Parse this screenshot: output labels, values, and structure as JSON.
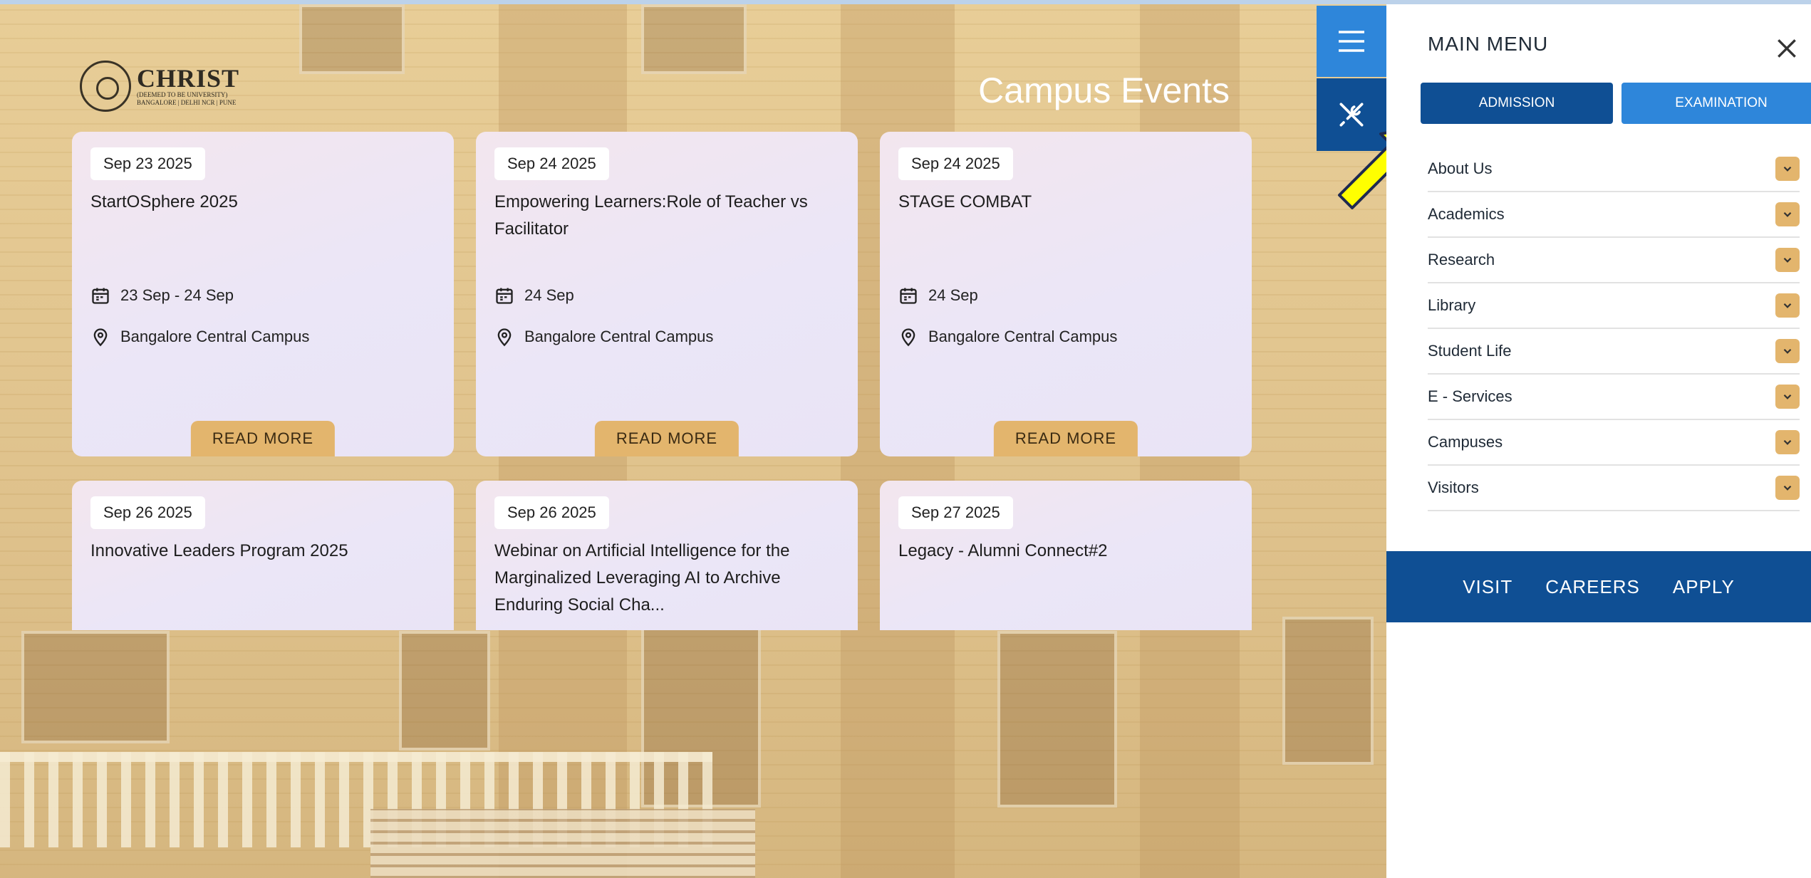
{
  "logo": {
    "name": "CHRIST",
    "sub1": "(DEEMED TO BE UNIVERSITY)",
    "sub2": "BANGALORE | DELHI NCR | PUNE"
  },
  "section_title": "Campus Events",
  "events": [
    {
      "date": "Sep 23 2025",
      "title": "StartOSphere 2025",
      "when": "23 Sep - 24 Sep",
      "where": "Bangalore Central Campus",
      "cta": "READ MORE"
    },
    {
      "date": "Sep 24 2025",
      "title": "Empowering Learners:Role of Teacher vs Facilitator",
      "when": "24 Sep",
      "where": "Bangalore Central Campus",
      "cta": "READ MORE"
    },
    {
      "date": "Sep 24 2025",
      "title": "STAGE COMBAT",
      "when": "24 Sep",
      "where": "Bangalore Central Campus",
      "cta": "READ MORE"
    },
    {
      "date": "Sep 26 2025",
      "title": "Innovative Leaders Program 2025"
    },
    {
      "date": "Sep 26 2025",
      "title": "Webinar on Artificial Intelligence for the Marginalized Leveraging AI to Archive Enduring Social Cha..."
    },
    {
      "date": "Sep 27 2025",
      "title": "Legacy - Alumni Connect#2"
    }
  ],
  "menu": {
    "title": "MAIN MENU",
    "tabs": [
      "ADMISSION",
      "EXAMINATION"
    ],
    "items": [
      "About Us",
      "Academics",
      "Research",
      "Library",
      "Student Life",
      "E - Services",
      "Campuses",
      "Visitors"
    ],
    "bottom": [
      "VISIT",
      "CAREERS",
      "APPLY"
    ]
  },
  "colors": {
    "dark_blue": "#0f4f94",
    "light_blue": "#2e86da",
    "gold": "#e3b56d",
    "arrow": "#ffff00"
  },
  "icons": [
    "hamburger-icon",
    "tools-icon",
    "calendar-icon",
    "location-pin-icon",
    "close-icon",
    "chevron-down-icon"
  ]
}
